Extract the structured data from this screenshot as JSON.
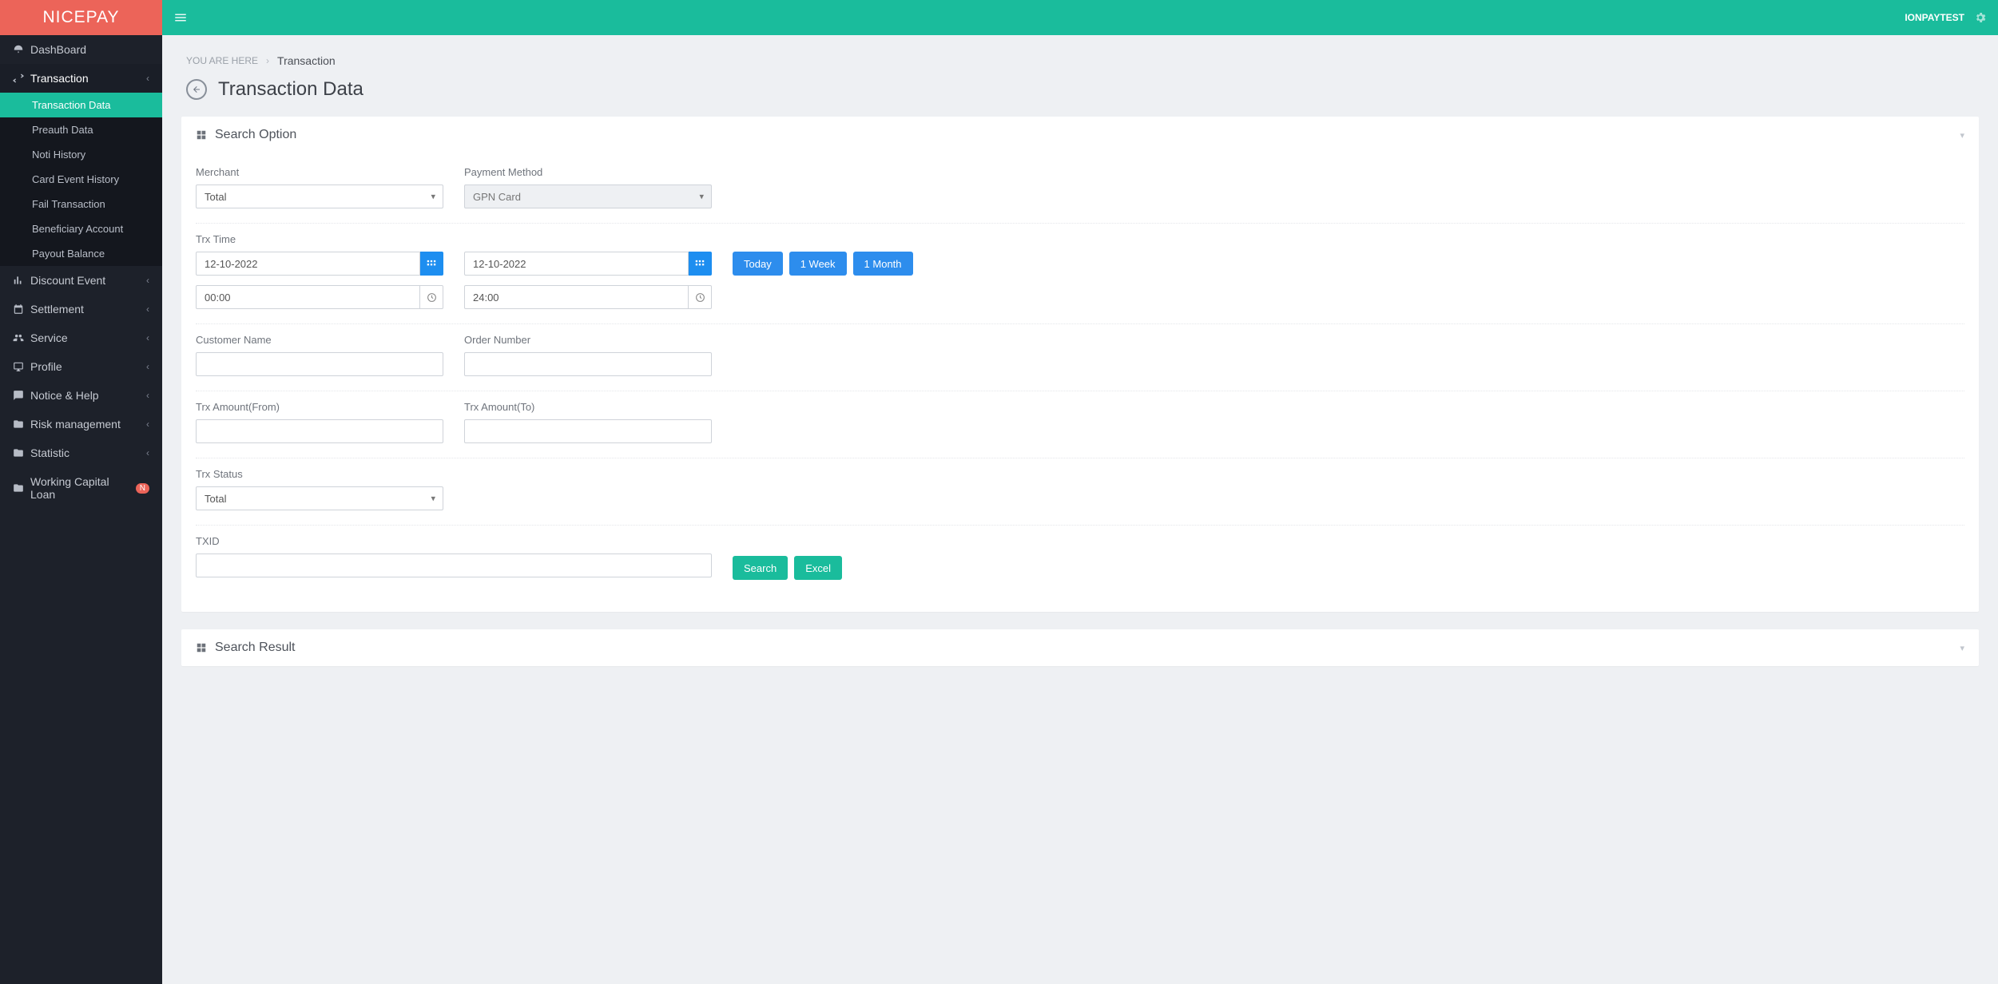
{
  "brand": "NICEPAY",
  "user": "IONPAYTEST",
  "breadcrumb": {
    "prefix": "YOU ARE HERE",
    "current": "Transaction"
  },
  "page_title": "Transaction Data",
  "sidebar": {
    "items": [
      {
        "label": "DashBoard"
      },
      {
        "label": "Transaction",
        "expanded": true,
        "children": [
          {
            "label": "Transaction Data",
            "selected": true
          },
          {
            "label": "Preauth Data"
          },
          {
            "label": "Noti History"
          },
          {
            "label": "Card Event History"
          },
          {
            "label": "Fail Transaction"
          },
          {
            "label": "Beneficiary Account"
          },
          {
            "label": "Payout Balance"
          }
        ]
      },
      {
        "label": "Discount Event"
      },
      {
        "label": "Settlement"
      },
      {
        "label": "Service"
      },
      {
        "label": "Profile"
      },
      {
        "label": "Notice & Help"
      },
      {
        "label": "Risk management"
      },
      {
        "label": "Statistic"
      },
      {
        "label": "Working Capital Loan",
        "badge": "N"
      }
    ]
  },
  "panels": {
    "search_option_title": "Search Option",
    "search_result_title": "Search Result"
  },
  "form": {
    "merchant": {
      "label": "Merchant",
      "value": "Total"
    },
    "payment_method": {
      "label": "Payment Method",
      "value": "GPN Card"
    },
    "trx_time_label": "Trx Time",
    "date_from": "12-10-2022",
    "date_to": "12-10-2022",
    "time_from": "00:00",
    "time_to": "24:00",
    "quick": {
      "today": "Today",
      "week": "1 Week",
      "month": "1 Month"
    },
    "customer_name": {
      "label": "Customer Name",
      "value": ""
    },
    "order_number": {
      "label": "Order Number",
      "value": ""
    },
    "amount_from": {
      "label": "Trx Amount(From)",
      "value": ""
    },
    "amount_to": {
      "label": "Trx Amount(To)",
      "value": ""
    },
    "trx_status": {
      "label": "Trx Status",
      "value": "Total"
    },
    "txid": {
      "label": "TXID",
      "value": ""
    },
    "search_btn": "Search",
    "excel_btn": "Excel"
  }
}
